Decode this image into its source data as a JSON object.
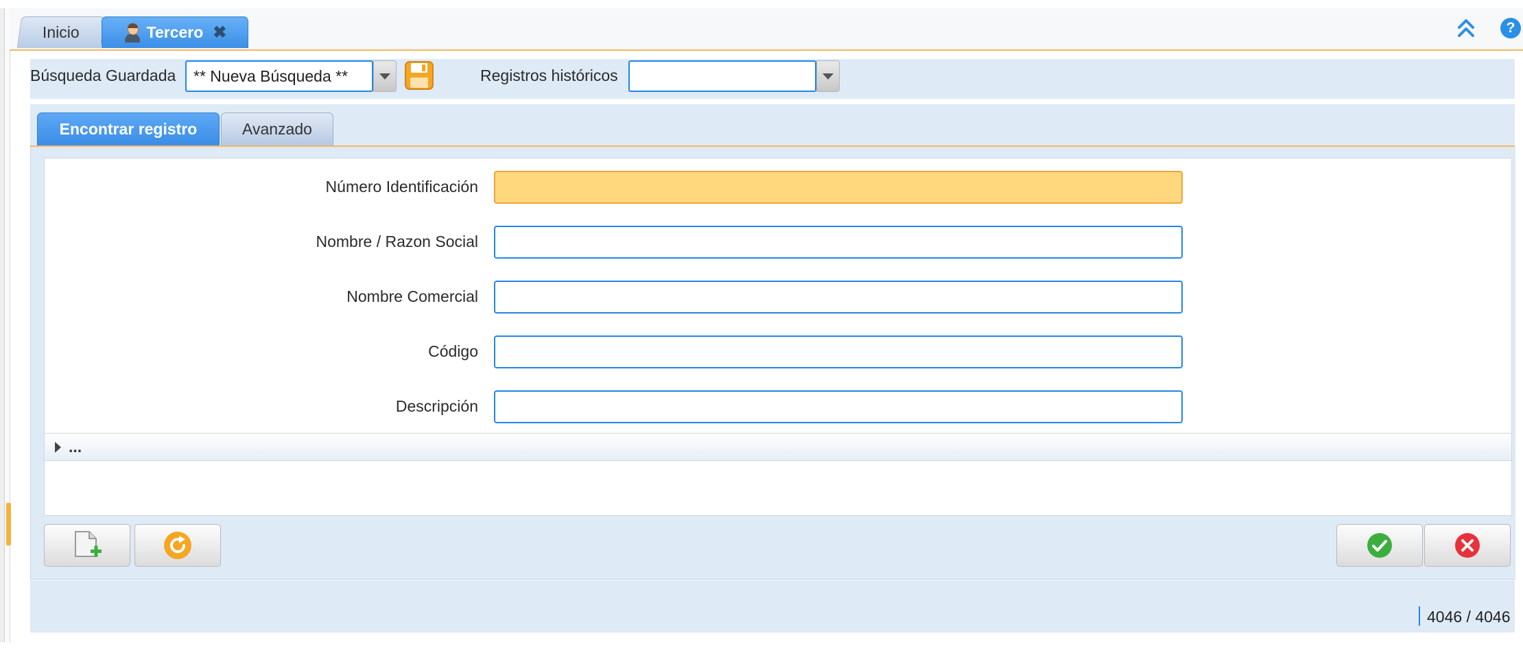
{
  "tabs": {
    "inicio": "Inicio",
    "tercero": "Tercero"
  },
  "search": {
    "saved_label": "Búsqueda Guardada",
    "saved_value": "** Nueva Búsqueda **",
    "history_label": "Registros históricos",
    "history_value": ""
  },
  "subtabs": {
    "find": "Encontrar registro",
    "advanced": "Avanzado"
  },
  "form": {
    "fields": [
      {
        "label": "Número Identificación",
        "value": ""
      },
      {
        "label": "Nombre / Razon Social",
        "value": ""
      },
      {
        "label": "Nombre Comercial",
        "value": ""
      },
      {
        "label": "Código",
        "value": ""
      },
      {
        "label": "Descripción",
        "value": ""
      }
    ],
    "more_label": "..."
  },
  "status": {
    "record_count": "4046 / 4046"
  },
  "colors": {
    "accent_blue": "#2186e8",
    "focus_orange": "#ffd77d",
    "ok_green": "#3cae3f",
    "cancel_red": "#e8323b",
    "refresh_orange": "#f5a623"
  },
  "icons": {
    "user": "user-icon",
    "close": "close-icon",
    "collapse": "double-chevron-up-icon",
    "help": "help-icon",
    "save": "floppy-disk-icon",
    "new": "new-document-icon",
    "refresh": "refresh-icon",
    "ok": "checkmark-icon",
    "cancel": "cancel-icon"
  }
}
